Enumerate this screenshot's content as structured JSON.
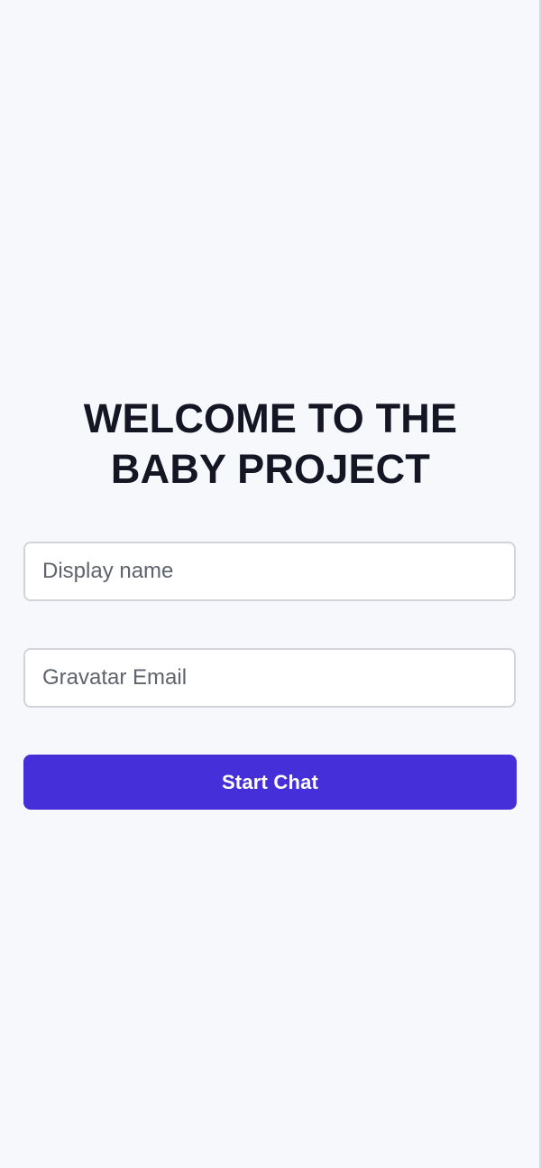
{
  "welcome": {
    "title": "WELCOME TO THE BABY PROJECT",
    "display_name": {
      "placeholder": "Display name",
      "value": ""
    },
    "email": {
      "placeholder": "Gravatar Email",
      "value": ""
    },
    "submit_label": "Start Chat"
  },
  "colors": {
    "background": "#f7f8fb",
    "title": "#141624",
    "accent": "#452fd9",
    "input_border": "#d2d4d9"
  }
}
